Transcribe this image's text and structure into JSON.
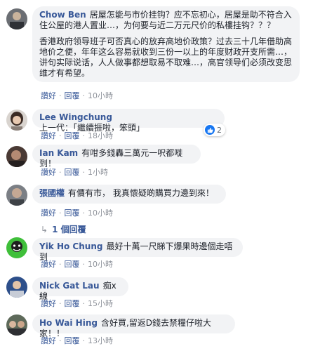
{
  "actions": {
    "like": "讚好",
    "reply": "回覆",
    "dot": "·"
  },
  "comments": [
    {
      "name": "Chow Ben",
      "paragraphs": [
        "居屋怎能与市价挂钩？应不忘初心，居屋是助不符合入住公屋的港人置业…，为何要与近二万元尺价的私樓挂钩？？？",
        "香港政府领导班子可否真心的放弃高地价政策？过去三十几年借助高地价之便，年年这么容易就收到三份一以上的年度财政开支所需…，讲句实际说话，人人做事都想取易不取难…，高官领导们必须改变思维才有希望。"
      ],
      "time": "10小時"
    },
    {
      "name": "Lee Wingchung",
      "text": "上一代：「繼續捱啦，笨頭」",
      "time": "18小時",
      "reactions": "2"
    },
    {
      "name": "Ian Kam",
      "text": "有咁多錢轟三萬元一呎都嘥到！",
      "time": "1小時"
    },
    {
      "name": "張國權",
      "text": "有價有市， 我真懷疑啲購買力邊到來！",
      "time": "10小時",
      "replies": "1 個回覆"
    },
    {
      "name": "Yik Ho Chung",
      "text": "最好十萬一尺睇下爆果時邊個走唔到",
      "time": "10小時"
    },
    {
      "name": "Nick Gat Lau",
      "text": "痴x線",
      "time": "15小時"
    },
    {
      "name": "Ho Wai Hing",
      "text": "含好買,留返D錢去禁糧仔啦大家！！",
      "time": "13小時"
    }
  ]
}
